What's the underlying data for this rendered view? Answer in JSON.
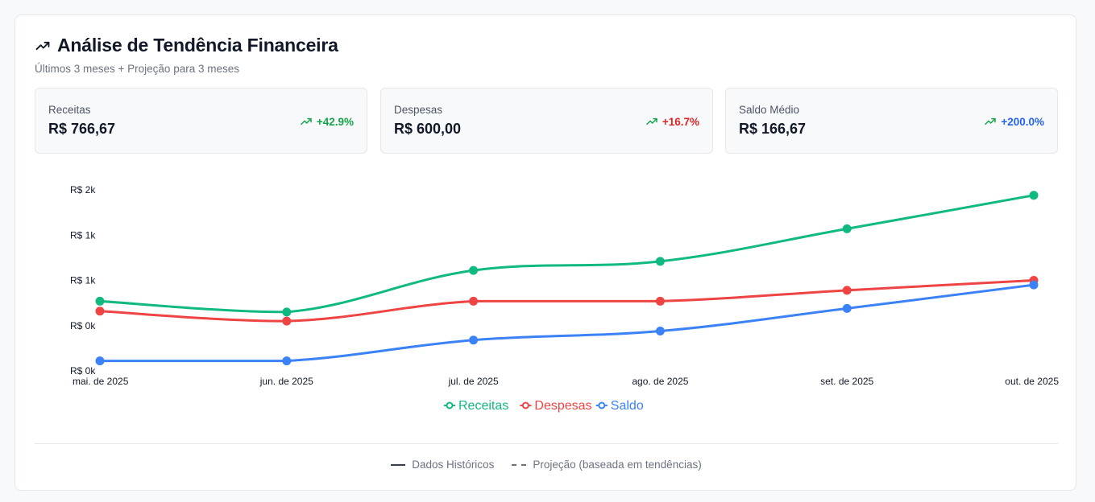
{
  "header": {
    "title": "Análise de Tendência Financeira",
    "subtitle": "Últimos 3 meses + Projeção para 3 meses",
    "icon": "trending-up-icon"
  },
  "stats": [
    {
      "label": "Receitas",
      "value": "R$ 766,67",
      "change": "+42.9%",
      "color": "#16a34a"
    },
    {
      "label": "Despesas",
      "value": "R$ 600,00",
      "change": "+16.7%",
      "color": "#dc2626"
    },
    {
      "label": "Saldo Médio",
      "value": "R$ 166,67",
      "change": "+200.0%",
      "color": "#2563eb"
    }
  ],
  "chart_data": {
    "type": "line",
    "x": [
      "mai. de 2025",
      "jun. de 2025",
      "jul. de 2025",
      "ago. de 2025",
      "set. de 2025",
      "out. de 2025"
    ],
    "y_ticks": [
      "R$ 0k",
      "R$ 0k",
      "R$ 1k",
      "R$ 1k",
      "R$ 2k"
    ],
    "y_tick_values": [
      0,
      500,
      1000,
      1500,
      2000
    ],
    "ylim": [
      0,
      2000
    ],
    "series": [
      {
        "name": "Receitas",
        "color": "#10b981",
        "values": [
          770,
          650,
          1110,
          1210,
          1570,
          1940
        ]
      },
      {
        "name": "Despesas",
        "color": "#ef4444",
        "values": [
          660,
          550,
          770,
          770,
          890,
          1000
        ]
      },
      {
        "name": "Saldo",
        "color": "#3b82f6",
        "values": [
          110,
          110,
          340,
          440,
          690,
          950
        ]
      }
    ],
    "grid": false,
    "legend": "bottom-center"
  },
  "footer": {
    "historical": "Dados Históricos",
    "projection": "Projeção (baseada em tendências)"
  }
}
